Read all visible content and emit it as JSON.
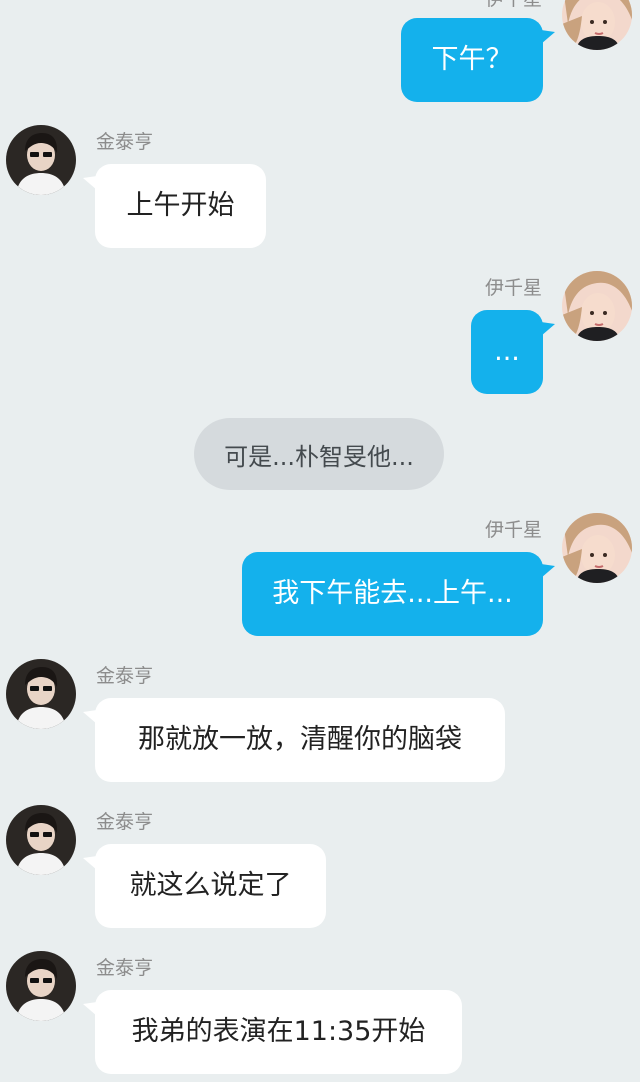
{
  "colors": {
    "background": "#e9eeef",
    "incoming_bubble": "#ffffff",
    "outgoing_bubble": "#14b1ec",
    "system_bubble": "#d5dadd",
    "name_text": "#8c8c8c"
  },
  "participants": {
    "female": {
      "name": "伊千星",
      "avatar_icon": "female-avatar-icon"
    },
    "male": {
      "name": "金泰亨",
      "avatar_icon": "male-avatar-icon"
    }
  },
  "messages": [
    {
      "side": "right",
      "sender": "伊千星",
      "text": "下午？"
    },
    {
      "side": "left",
      "sender": "金泰亨",
      "text": "上午开始"
    },
    {
      "side": "right",
      "sender": "伊千星",
      "text": "..."
    },
    {
      "side": "center",
      "sender": "",
      "text": "可是...朴智旻他..."
    },
    {
      "side": "right",
      "sender": "伊千星",
      "text": "我下午能去...上午..."
    },
    {
      "side": "left",
      "sender": "金泰亨",
      "text": "那就放一放，清醒你的脑袋"
    },
    {
      "side": "left",
      "sender": "金泰亨",
      "text": "就这么说定了"
    },
    {
      "side": "left",
      "sender": "金泰亨",
      "text": "我弟的表演在11:35开始"
    }
  ]
}
